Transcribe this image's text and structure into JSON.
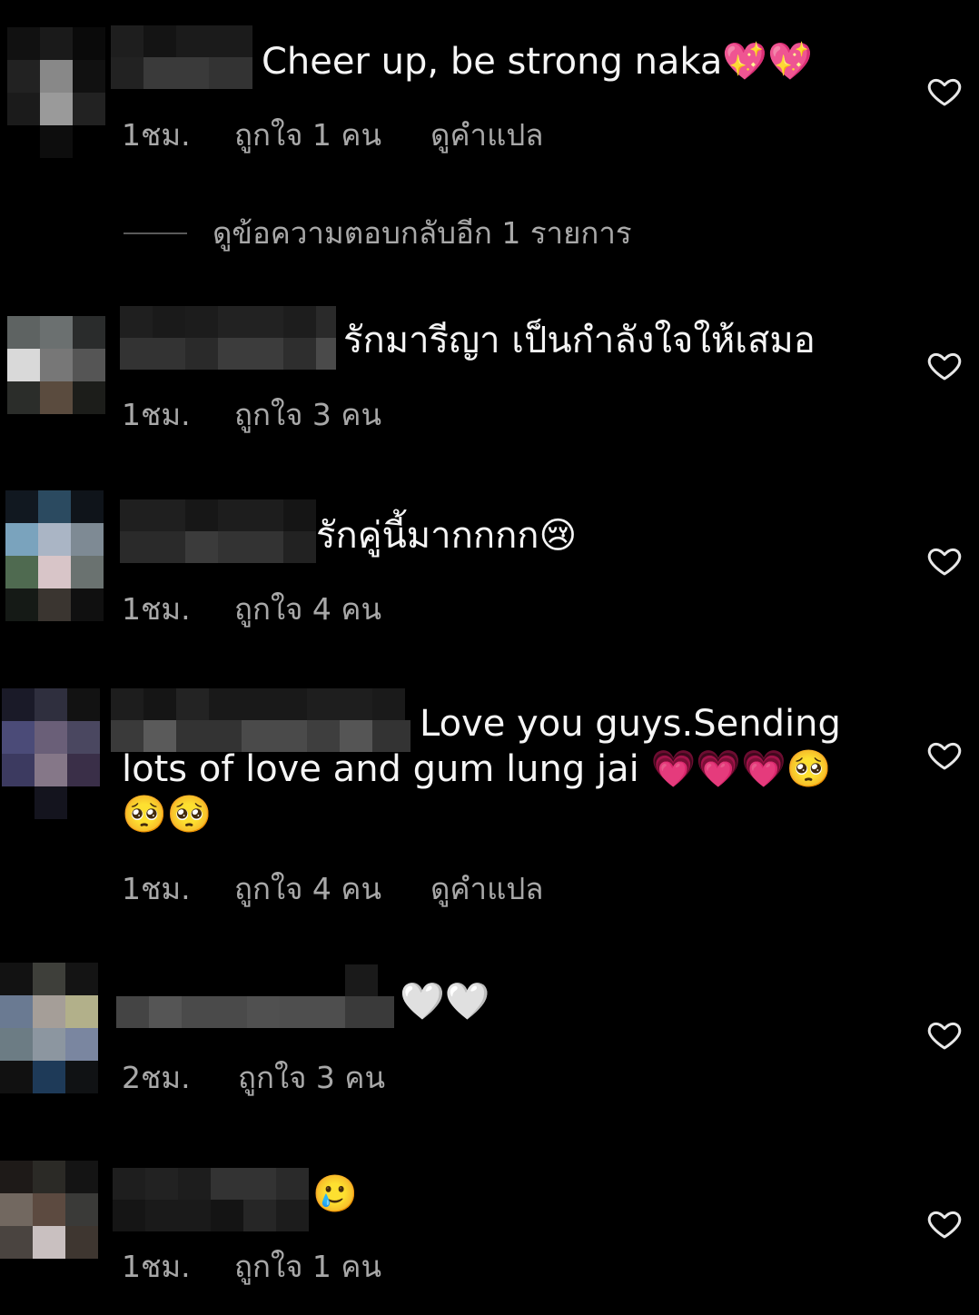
{
  "comments": [
    {
      "text": "Cheer up, be strong naka💖💖",
      "time": "1ชม.",
      "likes": "ถูกใจ 1 คน",
      "translate": "ดูคำแปล"
    },
    {
      "text": "รักมารีญา เป็นกำลังใจให้เสมอ",
      "time": "1ชม.",
      "likes": "ถูกใจ 3 คน",
      "translate": ""
    },
    {
      "text": "รักคู่นี้มากกกก😢",
      "time": "1ชม.",
      "likes": "ถูกใจ 4 คน",
      "translate": ""
    },
    {
      "text": "Love you guys.Sending lots of love and gum lung jai 💗💗💗🥺🥺🥺",
      "time": "1ชม.",
      "likes": "ถูกใจ 4 คน",
      "translate": "ดูคำแปล"
    },
    {
      "text": "🤍🤍",
      "time": "2ชม.",
      "likes": "ถูกใจ 3 คน",
      "translate": ""
    },
    {
      "text": "🥲",
      "time": "1ชม.",
      "likes": "ถูกใจ 1 คน",
      "translate": ""
    }
  ],
  "view_replies": "ดูข้อความตอบกลับอีก 1 รายการ",
  "icons": {
    "like": "heart-outline-icon"
  },
  "colors": {
    "background": "#000000",
    "text": "#f5f5f5",
    "secondary": "#a8a8a8"
  }
}
